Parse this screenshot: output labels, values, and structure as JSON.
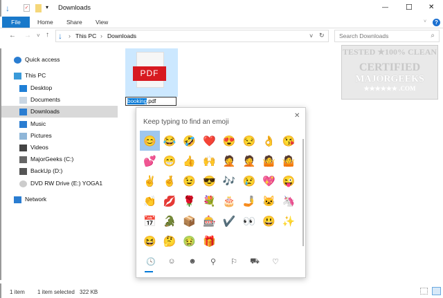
{
  "title": "Downloads",
  "window_controls": {
    "minimize": "—",
    "maximize": "☐",
    "close": "✕"
  },
  "ribbon": {
    "tabs": [
      "File",
      "Home",
      "Share",
      "View"
    ],
    "help": "?"
  },
  "address": {
    "back": "←",
    "forward": "→",
    "recent": "˅",
    "up": "↑",
    "crumbs": [
      "This PC",
      "Downloads"
    ],
    "sep": "›",
    "dropdown": "˅",
    "refresh": "↻"
  },
  "search": {
    "placeholder": "Search Downloads",
    "icon": "⌕"
  },
  "nav": [
    {
      "label": "Quick access",
      "icon": "star-icon",
      "color": "#2a7dd1"
    },
    {
      "label": "This PC",
      "icon": "computer-icon",
      "color": "#3a9ad9"
    },
    {
      "label": "Desktop",
      "icon": "desktop-icon",
      "color": "#1f7fd6"
    },
    {
      "label": "Documents",
      "icon": "documents-icon",
      "color": "#c9d6e3"
    },
    {
      "label": "Downloads",
      "icon": "downloads-icon",
      "color": "#2a7dd1"
    },
    {
      "label": "Music",
      "icon": "music-icon",
      "color": "#2a7dd1"
    },
    {
      "label": "Pictures",
      "icon": "pictures-icon",
      "color": "#8fb6d8"
    },
    {
      "label": "Videos",
      "icon": "videos-icon",
      "color": "#444"
    },
    {
      "label": "MajorGeeks (C:)",
      "icon": "drive-icon",
      "color": "#666"
    },
    {
      "label": "BackUp (D:)",
      "icon": "drive-icon",
      "color": "#555"
    },
    {
      "label": "DVD RW Drive (E:) YOGA1",
      "icon": "dvd-icon",
      "color": "#ccc"
    },
    {
      "label": "Network",
      "icon": "network-icon",
      "color": "#2a7dd1"
    }
  ],
  "file": {
    "icon_label": "PDF",
    "name_selected": "booking",
    "name_rest": ".pdf"
  },
  "watermark": {
    "line1": "TESTED ★100% CLEAN",
    "line2": "CERTIFIED",
    "line3": "MAJORGEEKS",
    "line4": "★★★★★★ .COM"
  },
  "emoji_panel": {
    "prompt": "Keep typing to find an emoji",
    "close": "✕",
    "emojis": [
      "😊",
      "😂",
      "🤣",
      "❤️",
      "😍",
      "😒",
      "👌",
      "😘",
      "💕",
      "😁",
      "👍",
      "🙌",
      "🤦",
      "🤦",
      "🤷",
      "🤷",
      "✌️",
      "🤞",
      "😉",
      "😎",
      "🎶",
      "😢",
      "💖",
      "😜",
      "👏",
      "💋",
      "🌹",
      "💐",
      "🎂",
      "🤳",
      "🐱",
      "🦄",
      "📅",
      "🐊",
      "📦",
      "🎰",
      "✔️",
      "👀",
      "😃",
      "✨",
      "😆",
      "🤔",
      "🤢",
      "🎁"
    ],
    "categories": [
      "🕓",
      "☺",
      "☻",
      "⚲",
      "⚐",
      "⛟",
      "♡"
    ]
  },
  "status": {
    "count": "1 item",
    "selected": "1 item selected",
    "size": "322 KB"
  }
}
